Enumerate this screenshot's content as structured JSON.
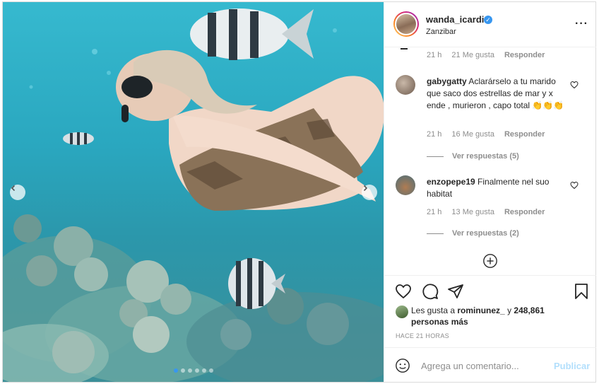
{
  "post": {
    "username": "wanda_icardi",
    "location": "Zanzibar",
    "verified": true,
    "media_position": {
      "current": 1,
      "total": 6
    }
  },
  "comments": {
    "prev_meta": {
      "time": "21 h",
      "likes": "21 Me gusta",
      "reply": "Responder"
    },
    "items": [
      {
        "user": "gabygatty",
        "text": "Aclarárselo a tu marido que saco dos estrellas de mar y x ende , murieron , capo total 👏👏👏",
        "time": "21 h",
        "likes": "16 Me gusta",
        "reply": "Responder",
        "view_replies": "Ver respuestas (5)"
      },
      {
        "user": "enzopepe19",
        "text": "Finalmente nel suo habitat",
        "time": "21 h",
        "likes": "13 Me gusta",
        "reply": "Responder",
        "view_replies": "Ver respuestas (2)"
      }
    ]
  },
  "likes": {
    "prefix": "Les gusta a",
    "user": "rominunez_",
    "join": "y",
    "count": "248,861 personas más"
  },
  "timestamp": "HACE 21 HORAS",
  "add_comment": {
    "placeholder": "Agrega un comentario...",
    "post_label": "Publicar"
  },
  "icons": {
    "like": "heart-icon",
    "comment": "comment-icon",
    "share": "paper-plane-icon",
    "save": "bookmark-icon",
    "emoji": "smiley-icon",
    "load_more": "plus-circle-icon",
    "prev": "chevron-left-icon",
    "next": "chevron-right-icon",
    "more": "ellipsis-icon"
  },
  "colors": {
    "accent": "#3897f0",
    "muted": "#8e8e8e",
    "post_disabled": "#b2dffc"
  }
}
